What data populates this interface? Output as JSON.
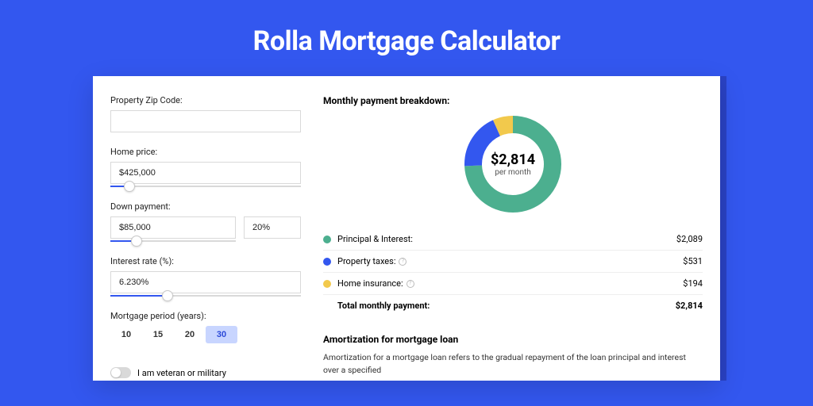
{
  "title": "Rolla Mortgage Calculator",
  "form": {
    "zip_label": "Property Zip Code:",
    "zip_value": "",
    "home_price_label": "Home price:",
    "home_price_value": "$425,000",
    "down_payment_label": "Down payment:",
    "down_payment_value": "$85,000",
    "down_payment_pct": "20%",
    "interest_label": "Interest rate (%):",
    "interest_value": "6.230%",
    "period_label": "Mortgage period (years):",
    "periods": [
      "10",
      "15",
      "20",
      "30"
    ],
    "period_selected": "30",
    "veteran_label": "I am veteran or military"
  },
  "breakdown": {
    "title": "Monthly payment breakdown:",
    "center_amount": "$2,814",
    "center_sub": "per month",
    "rows": [
      {
        "label": "Principal & Interest:",
        "value": "$2,089",
        "color": "green"
      },
      {
        "label": "Property taxes:",
        "value": "$531",
        "color": "blue",
        "info": true
      },
      {
        "label": "Home insurance:",
        "value": "$194",
        "color": "yellow",
        "info": true
      }
    ],
    "total_label": "Total monthly payment:",
    "total_value": "$2,814"
  },
  "amort": {
    "title": "Amortization for mortgage loan",
    "body": "Amortization for a mortgage loan refers to the gradual repayment of the loan principal and interest over a specified"
  },
  "chart_data": {
    "type": "pie",
    "title": "Monthly payment breakdown",
    "categories": [
      "Principal & Interest",
      "Property taxes",
      "Home insurance"
    ],
    "values": [
      2089,
      531,
      194
    ],
    "colors": [
      "#4caf8f",
      "#3357ef",
      "#f2c94c"
    ]
  }
}
